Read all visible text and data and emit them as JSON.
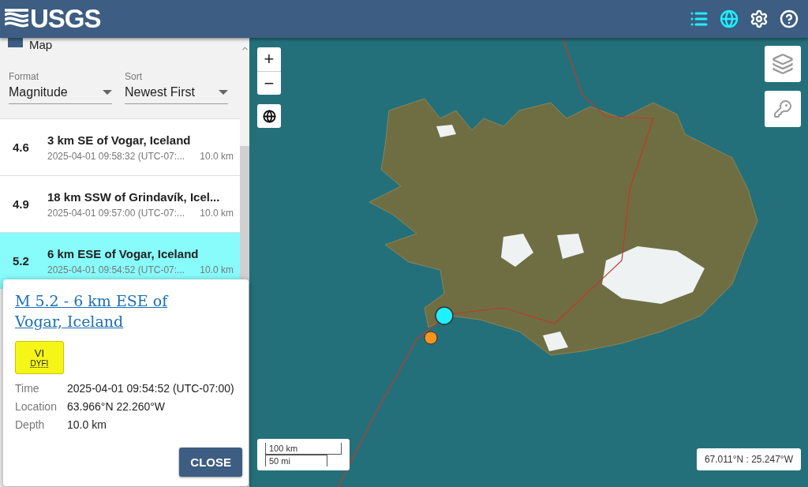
{
  "header": {
    "logo": "USGS",
    "icons": [
      {
        "kind": "list",
        "selected": true
      },
      {
        "kind": "globe",
        "selected": true
      },
      {
        "kind": "settings",
        "selected": false
      },
      {
        "kind": "help",
        "selected": false
      }
    ]
  },
  "panel": {
    "map_option": {
      "label": "Map",
      "checked": true
    },
    "format": {
      "label": "Format",
      "value": "Magnitude"
    },
    "sort": {
      "label": "Sort",
      "value": "Newest First"
    },
    "earthquakes": [
      {
        "magnitude": "4.6",
        "place": "3 km SE of Vogar, Iceland",
        "time": "2025-04-01 09:58:32 (UTC-07:...",
        "depth": "10.0 km",
        "selected": false
      },
      {
        "magnitude": "4.9",
        "place": "18 km SSW of Grindavík, Icel...",
        "time": "2025-04-01 09:57:00 (UTC-07:...",
        "depth": "10.0 km",
        "selected": false
      },
      {
        "magnitude": "5.2",
        "place": "6 km ESE of Vogar, Iceland",
        "time": "2025-04-01 09:54:52 (UTC-07:...",
        "depth": "10.0 km",
        "selected": true
      }
    ]
  },
  "popup": {
    "title": "M 5.2 - 6 km ESE of Vogar, Iceland",
    "badge": {
      "value": "VI",
      "label": "DYFI",
      "color": "#f5f518"
    },
    "details": [
      {
        "label": "Time",
        "value": "2025-04-01 09:54:52 (UTC-07:00)"
      },
      {
        "label": "Location",
        "value": "63.966°N 22.260°W"
      },
      {
        "label": "Depth",
        "value": "10.0 km"
      }
    ],
    "close": "CLOSE"
  },
  "map": {
    "controls": {
      "zoom_in": "+",
      "zoom_out": "−"
    },
    "markers": [
      {
        "color": "#1ff0ff",
        "selected": true
      },
      {
        "color": "#f7941d",
        "selected": false
      }
    ],
    "scale": {
      "metric": "100 km",
      "imperial": "50 mi"
    },
    "coordinates": "67.011°N : 25.247°W"
  }
}
